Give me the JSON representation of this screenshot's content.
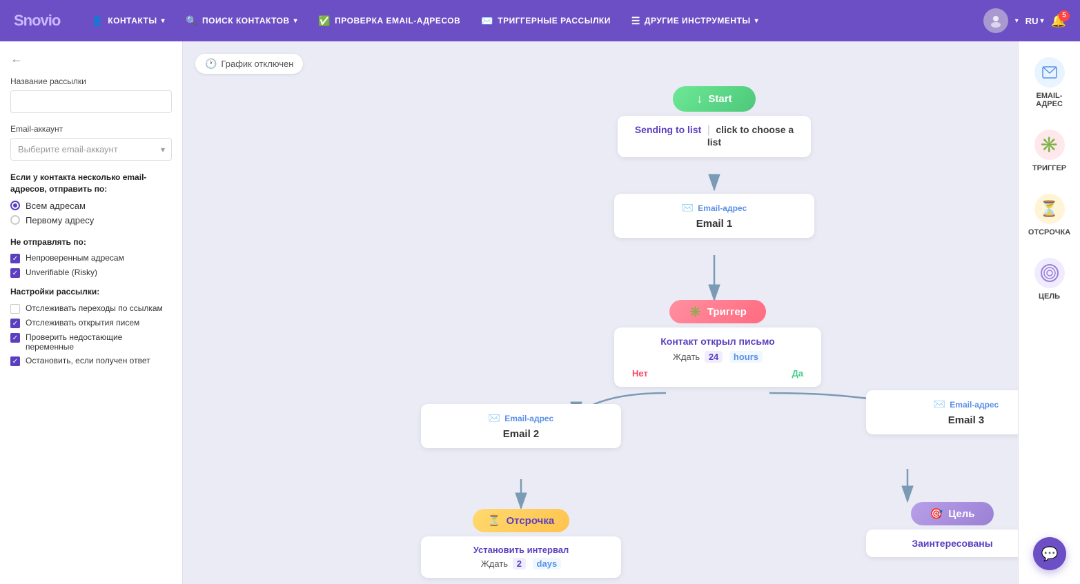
{
  "navbar": {
    "logo_main": "Snov",
    "logo_suffix": "io",
    "items": [
      {
        "id": "contacts",
        "label": "КОНТАКТЫ",
        "icon": "👤"
      },
      {
        "id": "search",
        "label": "ПОИСК КОНТАКТОВ",
        "icon": "🔍"
      },
      {
        "id": "verify",
        "label": "ПРОВЕРКА EMAIL-АДРЕСОВ",
        "icon": "✅"
      },
      {
        "id": "trigger",
        "label": "ТРИГГЕРНЫЕ РАССЫЛКИ",
        "icon": "✉️"
      },
      {
        "id": "tools",
        "label": "ДРУГИЕ ИНСТРУМЕНТЫ",
        "icon": "☰"
      }
    ],
    "lang": "RU",
    "bell_count": "5"
  },
  "sidebar": {
    "back_icon": "←",
    "campaign_name_label": "Название рассылки",
    "campaign_name_placeholder": "",
    "email_account_label": "Email-аккаунт",
    "email_account_placeholder": "Выберите email-аккаунт",
    "multiple_emails_title": "Если у контакта несколько email-адресов, отправить по:",
    "radio_all": "Всем адресам",
    "radio_first": "Первому адресу",
    "do_not_send_title": "Не отправлять по:",
    "check_unverified": "Непроверенным адресам",
    "check_unverifiable": "Unverifiable (Risky)",
    "settings_title": "Настройки рассылки:",
    "check_track_clicks": "Отслеживать переходы по ссылкам",
    "check_track_opens": "Отслеживать открытия писем",
    "check_missing_vars": "Проверить недостающие переменные",
    "check_stop_on_reply": "Остановить, если получен ответ"
  },
  "schedule_badge": {
    "label": "График отключен"
  },
  "flow": {
    "start_label": "Start",
    "sending_to_label": "Sending to list",
    "click_to_choose": "click to choose a list",
    "email1_header": "Email-адрес",
    "email1_title": "Email 1",
    "trigger_header": "Триггер",
    "trigger_contact_text": "Контакт открыл письмо",
    "trigger_wait_label": "Ждать",
    "trigger_wait_num": "24",
    "trigger_wait_unit": "hours",
    "trigger_no": "Нет",
    "trigger_yes": "Да",
    "email2_header": "Email-адрес",
    "email2_title": "Email 2",
    "email3_header": "Email-адрес",
    "email3_title": "Email 3",
    "delay_header": "Отсрочка",
    "delay_set_label": "Установить интервал",
    "delay_wait_label": "Ждать",
    "delay_wait_num": "2",
    "delay_wait_unit": "days",
    "goal_header": "Цель",
    "goal_text": "Заинтересованы"
  },
  "right_panel": {
    "tools": [
      {
        "id": "email",
        "icon": "✉️",
        "label": "EMAIL-\nАДРЕС",
        "color_class": "email"
      },
      {
        "id": "trigger",
        "icon": "✳️",
        "label": "ТРИГГЕР",
        "color_class": "trigger"
      },
      {
        "id": "delay",
        "icon": "⏳",
        "label": "ОТСРОЧКА",
        "color_class": "delay"
      },
      {
        "id": "goal",
        "icon": "🎯",
        "label": "ЦЕЛЬ",
        "color_class": "goal"
      }
    ]
  },
  "chat_button": {
    "icon": "💬"
  }
}
